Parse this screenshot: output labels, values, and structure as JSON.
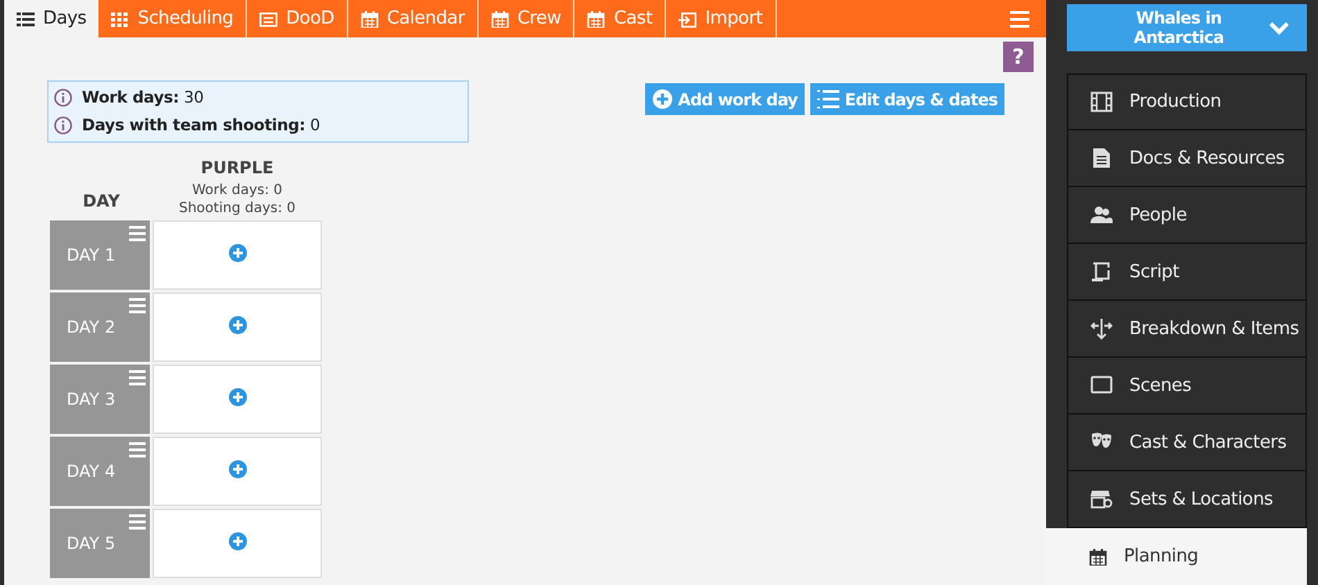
{
  "tabs": [
    {
      "label": "Days",
      "selected": true
    },
    {
      "label": "Scheduling",
      "selected": false
    },
    {
      "label": "DooD",
      "selected": false
    },
    {
      "label": "Calendar",
      "selected": false
    },
    {
      "label": "Crew",
      "selected": false
    },
    {
      "label": "Cast",
      "selected": false
    },
    {
      "label": "Import",
      "selected": false
    }
  ],
  "help": "?",
  "info": [
    {
      "label": "Work days:",
      "value": "30"
    },
    {
      "label": "Days with team shooting:",
      "value": "0"
    }
  ],
  "actions": [
    "Add work day",
    "Edit days & dates"
  ],
  "board": {
    "day_heading": "DAY",
    "team": {
      "name": "PURPLE",
      "work_days": "Work days: 0",
      "shooting_days": "Shooting days: 0"
    },
    "days": [
      "DAY 1",
      "DAY 2",
      "DAY 3",
      "DAY 4",
      "DAY 5"
    ]
  },
  "project": "Whales in Antarctica",
  "sidebar": [
    {
      "label": "Production",
      "selected": false
    },
    {
      "label": "Docs & Resources",
      "selected": false
    },
    {
      "label": "People",
      "selected": false
    },
    {
      "label": "Script",
      "selected": false
    },
    {
      "label": "Breakdown & Items",
      "selected": false
    },
    {
      "label": "Scenes",
      "selected": false
    },
    {
      "label": "Cast & Characters",
      "selected": false
    },
    {
      "label": "Sets & Locations",
      "selected": false
    },
    {
      "label": "Planning",
      "selected": true
    }
  ]
}
